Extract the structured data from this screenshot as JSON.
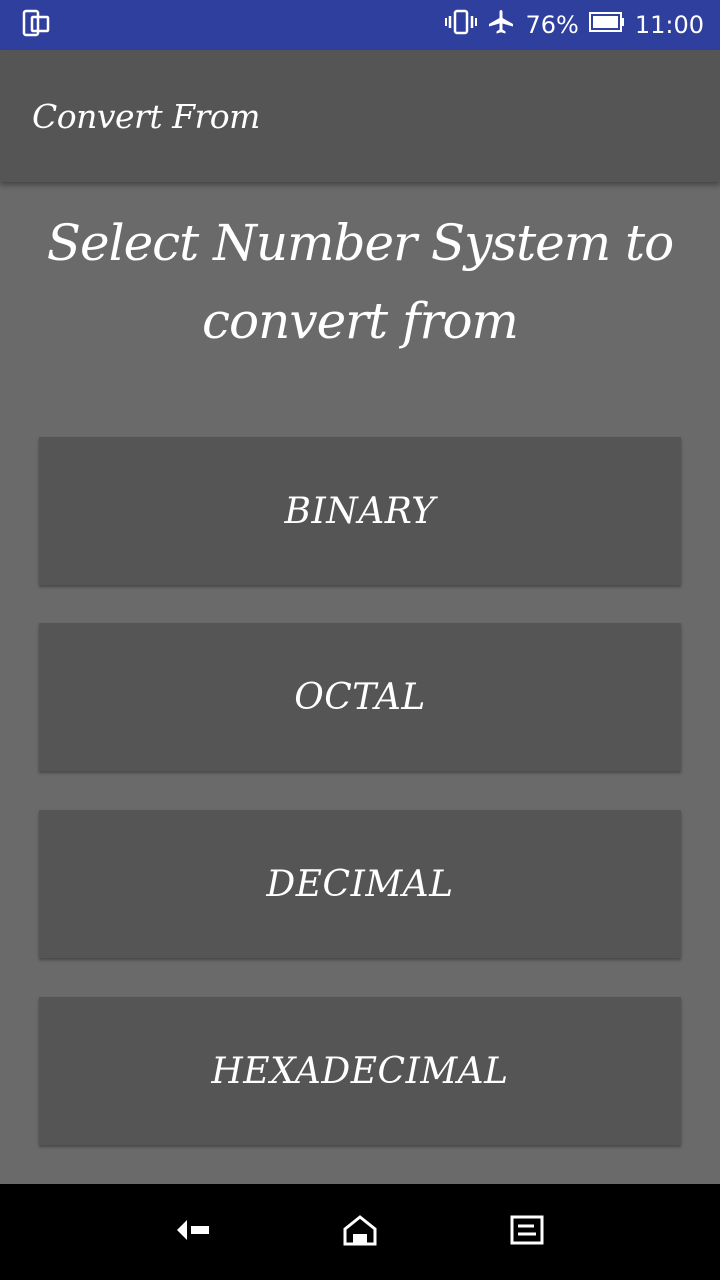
{
  "status_bar": {
    "left_icon": "screen-mirror-icon",
    "vibrate_icon": "vibrate-icon",
    "airplane_icon": "airplane-icon",
    "battery_percent": "76%",
    "battery_icon": "battery-icon",
    "time": "11:00",
    "background_color": "#2f3f9e"
  },
  "app_bar": {
    "title": "Convert From"
  },
  "main": {
    "heading": "Select Number System to convert from",
    "buttons": [
      {
        "label": "BINARY"
      },
      {
        "label": "OCTAL"
      },
      {
        "label": "DECIMAL"
      },
      {
        "label": "HEXADECIMAL"
      }
    ]
  },
  "nav_bar": {
    "back_icon": "back-icon",
    "home_icon": "home-icon",
    "recents_icon": "recents-icon"
  }
}
